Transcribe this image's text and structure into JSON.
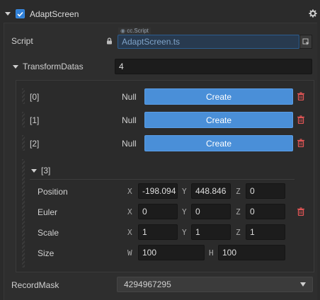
{
  "component": {
    "title": "AdaptScreen",
    "enabled": true
  },
  "script": {
    "label": "Script",
    "tag": "cc.Script",
    "value": "AdaptScreen.ts"
  },
  "transform_datas": {
    "label": "TransformDatas",
    "count": "4",
    "items": [
      {
        "index": "[0]",
        "value": "Null",
        "button": "Create"
      },
      {
        "index": "[1]",
        "value": "Null",
        "button": "Create"
      },
      {
        "index": "[2]",
        "value": "Null",
        "button": "Create"
      }
    ],
    "expanded": {
      "index": "[3]",
      "position": {
        "label": "Position",
        "x": "-198.094",
        "y": "448.846",
        "z": "0"
      },
      "euler": {
        "label": "Euler",
        "x": "0",
        "y": "0",
        "z": "0"
      },
      "scale": {
        "label": "Scale",
        "x": "1",
        "y": "1",
        "z": "1"
      },
      "size": {
        "label": "Size",
        "w": "100",
        "h": "100"
      }
    }
  },
  "axes": {
    "x": "X",
    "y": "Y",
    "z": "Z",
    "w": "W",
    "h": "H"
  },
  "record_mask": {
    "label": "RecordMask",
    "value": "4294967295"
  },
  "colors": {
    "accent": "#4a8fd8",
    "delete": "#e05555",
    "background": "#2b2b2b"
  }
}
